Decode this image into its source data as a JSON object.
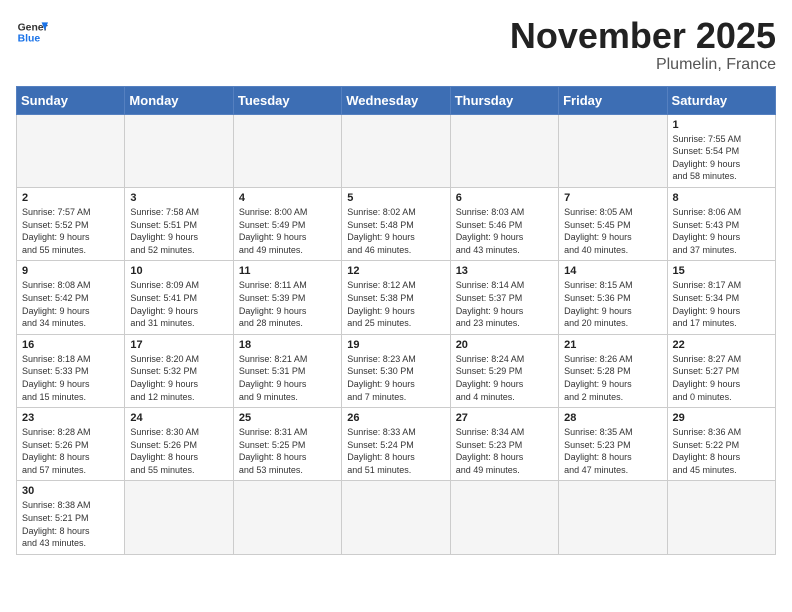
{
  "header": {
    "logo_general": "General",
    "logo_blue": "Blue",
    "month_title": "November 2025",
    "location": "Plumelin, France"
  },
  "days_of_week": [
    "Sunday",
    "Monday",
    "Tuesday",
    "Wednesday",
    "Thursday",
    "Friday",
    "Saturday"
  ],
  "weeks": [
    [
      {
        "day": "",
        "info": ""
      },
      {
        "day": "",
        "info": ""
      },
      {
        "day": "",
        "info": ""
      },
      {
        "day": "",
        "info": ""
      },
      {
        "day": "",
        "info": ""
      },
      {
        "day": "",
        "info": ""
      },
      {
        "day": "1",
        "info": "Sunrise: 7:55 AM\nSunset: 5:54 PM\nDaylight: 9 hours\nand 58 minutes."
      }
    ],
    [
      {
        "day": "2",
        "info": "Sunrise: 7:57 AM\nSunset: 5:52 PM\nDaylight: 9 hours\nand 55 minutes."
      },
      {
        "day": "3",
        "info": "Sunrise: 7:58 AM\nSunset: 5:51 PM\nDaylight: 9 hours\nand 52 minutes."
      },
      {
        "day": "4",
        "info": "Sunrise: 8:00 AM\nSunset: 5:49 PM\nDaylight: 9 hours\nand 49 minutes."
      },
      {
        "day": "5",
        "info": "Sunrise: 8:02 AM\nSunset: 5:48 PM\nDaylight: 9 hours\nand 46 minutes."
      },
      {
        "day": "6",
        "info": "Sunrise: 8:03 AM\nSunset: 5:46 PM\nDaylight: 9 hours\nand 43 minutes."
      },
      {
        "day": "7",
        "info": "Sunrise: 8:05 AM\nSunset: 5:45 PM\nDaylight: 9 hours\nand 40 minutes."
      },
      {
        "day": "8",
        "info": "Sunrise: 8:06 AM\nSunset: 5:43 PM\nDaylight: 9 hours\nand 37 minutes."
      }
    ],
    [
      {
        "day": "9",
        "info": "Sunrise: 8:08 AM\nSunset: 5:42 PM\nDaylight: 9 hours\nand 34 minutes."
      },
      {
        "day": "10",
        "info": "Sunrise: 8:09 AM\nSunset: 5:41 PM\nDaylight: 9 hours\nand 31 minutes."
      },
      {
        "day": "11",
        "info": "Sunrise: 8:11 AM\nSunset: 5:39 PM\nDaylight: 9 hours\nand 28 minutes."
      },
      {
        "day": "12",
        "info": "Sunrise: 8:12 AM\nSunset: 5:38 PM\nDaylight: 9 hours\nand 25 minutes."
      },
      {
        "day": "13",
        "info": "Sunrise: 8:14 AM\nSunset: 5:37 PM\nDaylight: 9 hours\nand 23 minutes."
      },
      {
        "day": "14",
        "info": "Sunrise: 8:15 AM\nSunset: 5:36 PM\nDaylight: 9 hours\nand 20 minutes."
      },
      {
        "day": "15",
        "info": "Sunrise: 8:17 AM\nSunset: 5:34 PM\nDaylight: 9 hours\nand 17 minutes."
      }
    ],
    [
      {
        "day": "16",
        "info": "Sunrise: 8:18 AM\nSunset: 5:33 PM\nDaylight: 9 hours\nand 15 minutes."
      },
      {
        "day": "17",
        "info": "Sunrise: 8:20 AM\nSunset: 5:32 PM\nDaylight: 9 hours\nand 12 minutes."
      },
      {
        "day": "18",
        "info": "Sunrise: 8:21 AM\nSunset: 5:31 PM\nDaylight: 9 hours\nand 9 minutes."
      },
      {
        "day": "19",
        "info": "Sunrise: 8:23 AM\nSunset: 5:30 PM\nDaylight: 9 hours\nand 7 minutes."
      },
      {
        "day": "20",
        "info": "Sunrise: 8:24 AM\nSunset: 5:29 PM\nDaylight: 9 hours\nand 4 minutes."
      },
      {
        "day": "21",
        "info": "Sunrise: 8:26 AM\nSunset: 5:28 PM\nDaylight: 9 hours\nand 2 minutes."
      },
      {
        "day": "22",
        "info": "Sunrise: 8:27 AM\nSunset: 5:27 PM\nDaylight: 9 hours\nand 0 minutes."
      }
    ],
    [
      {
        "day": "23",
        "info": "Sunrise: 8:28 AM\nSunset: 5:26 PM\nDaylight: 8 hours\nand 57 minutes."
      },
      {
        "day": "24",
        "info": "Sunrise: 8:30 AM\nSunset: 5:26 PM\nDaylight: 8 hours\nand 55 minutes."
      },
      {
        "day": "25",
        "info": "Sunrise: 8:31 AM\nSunset: 5:25 PM\nDaylight: 8 hours\nand 53 minutes."
      },
      {
        "day": "26",
        "info": "Sunrise: 8:33 AM\nSunset: 5:24 PM\nDaylight: 8 hours\nand 51 minutes."
      },
      {
        "day": "27",
        "info": "Sunrise: 8:34 AM\nSunset: 5:23 PM\nDaylight: 8 hours\nand 49 minutes."
      },
      {
        "day": "28",
        "info": "Sunrise: 8:35 AM\nSunset: 5:23 PM\nDaylight: 8 hours\nand 47 minutes."
      },
      {
        "day": "29",
        "info": "Sunrise: 8:36 AM\nSunset: 5:22 PM\nDaylight: 8 hours\nand 45 minutes."
      }
    ],
    [
      {
        "day": "30",
        "info": "Sunrise: 8:38 AM\nSunset: 5:21 PM\nDaylight: 8 hours\nand 43 minutes."
      },
      {
        "day": "",
        "info": ""
      },
      {
        "day": "",
        "info": ""
      },
      {
        "day": "",
        "info": ""
      },
      {
        "day": "",
        "info": ""
      },
      {
        "day": "",
        "info": ""
      },
      {
        "day": "",
        "info": ""
      }
    ]
  ]
}
